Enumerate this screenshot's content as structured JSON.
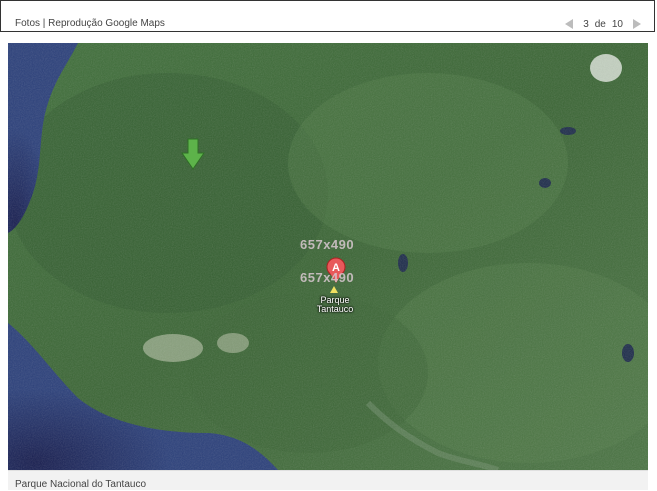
{
  "header": {
    "title": "Fotos | Reprodução Google Maps",
    "pager": {
      "current": "3",
      "separator": "de",
      "total": "10"
    }
  },
  "map": {
    "marker_letter": "A",
    "place_label": "Parque\nTantauco",
    "watermark_text": "657x490",
    "colors": {
      "forest": "#3c6a38",
      "ocean": "#1a2a66",
      "marker": "#e8595b",
      "arrow": "#5db34a"
    }
  },
  "caption": "Parque Nacional do Tantauco"
}
